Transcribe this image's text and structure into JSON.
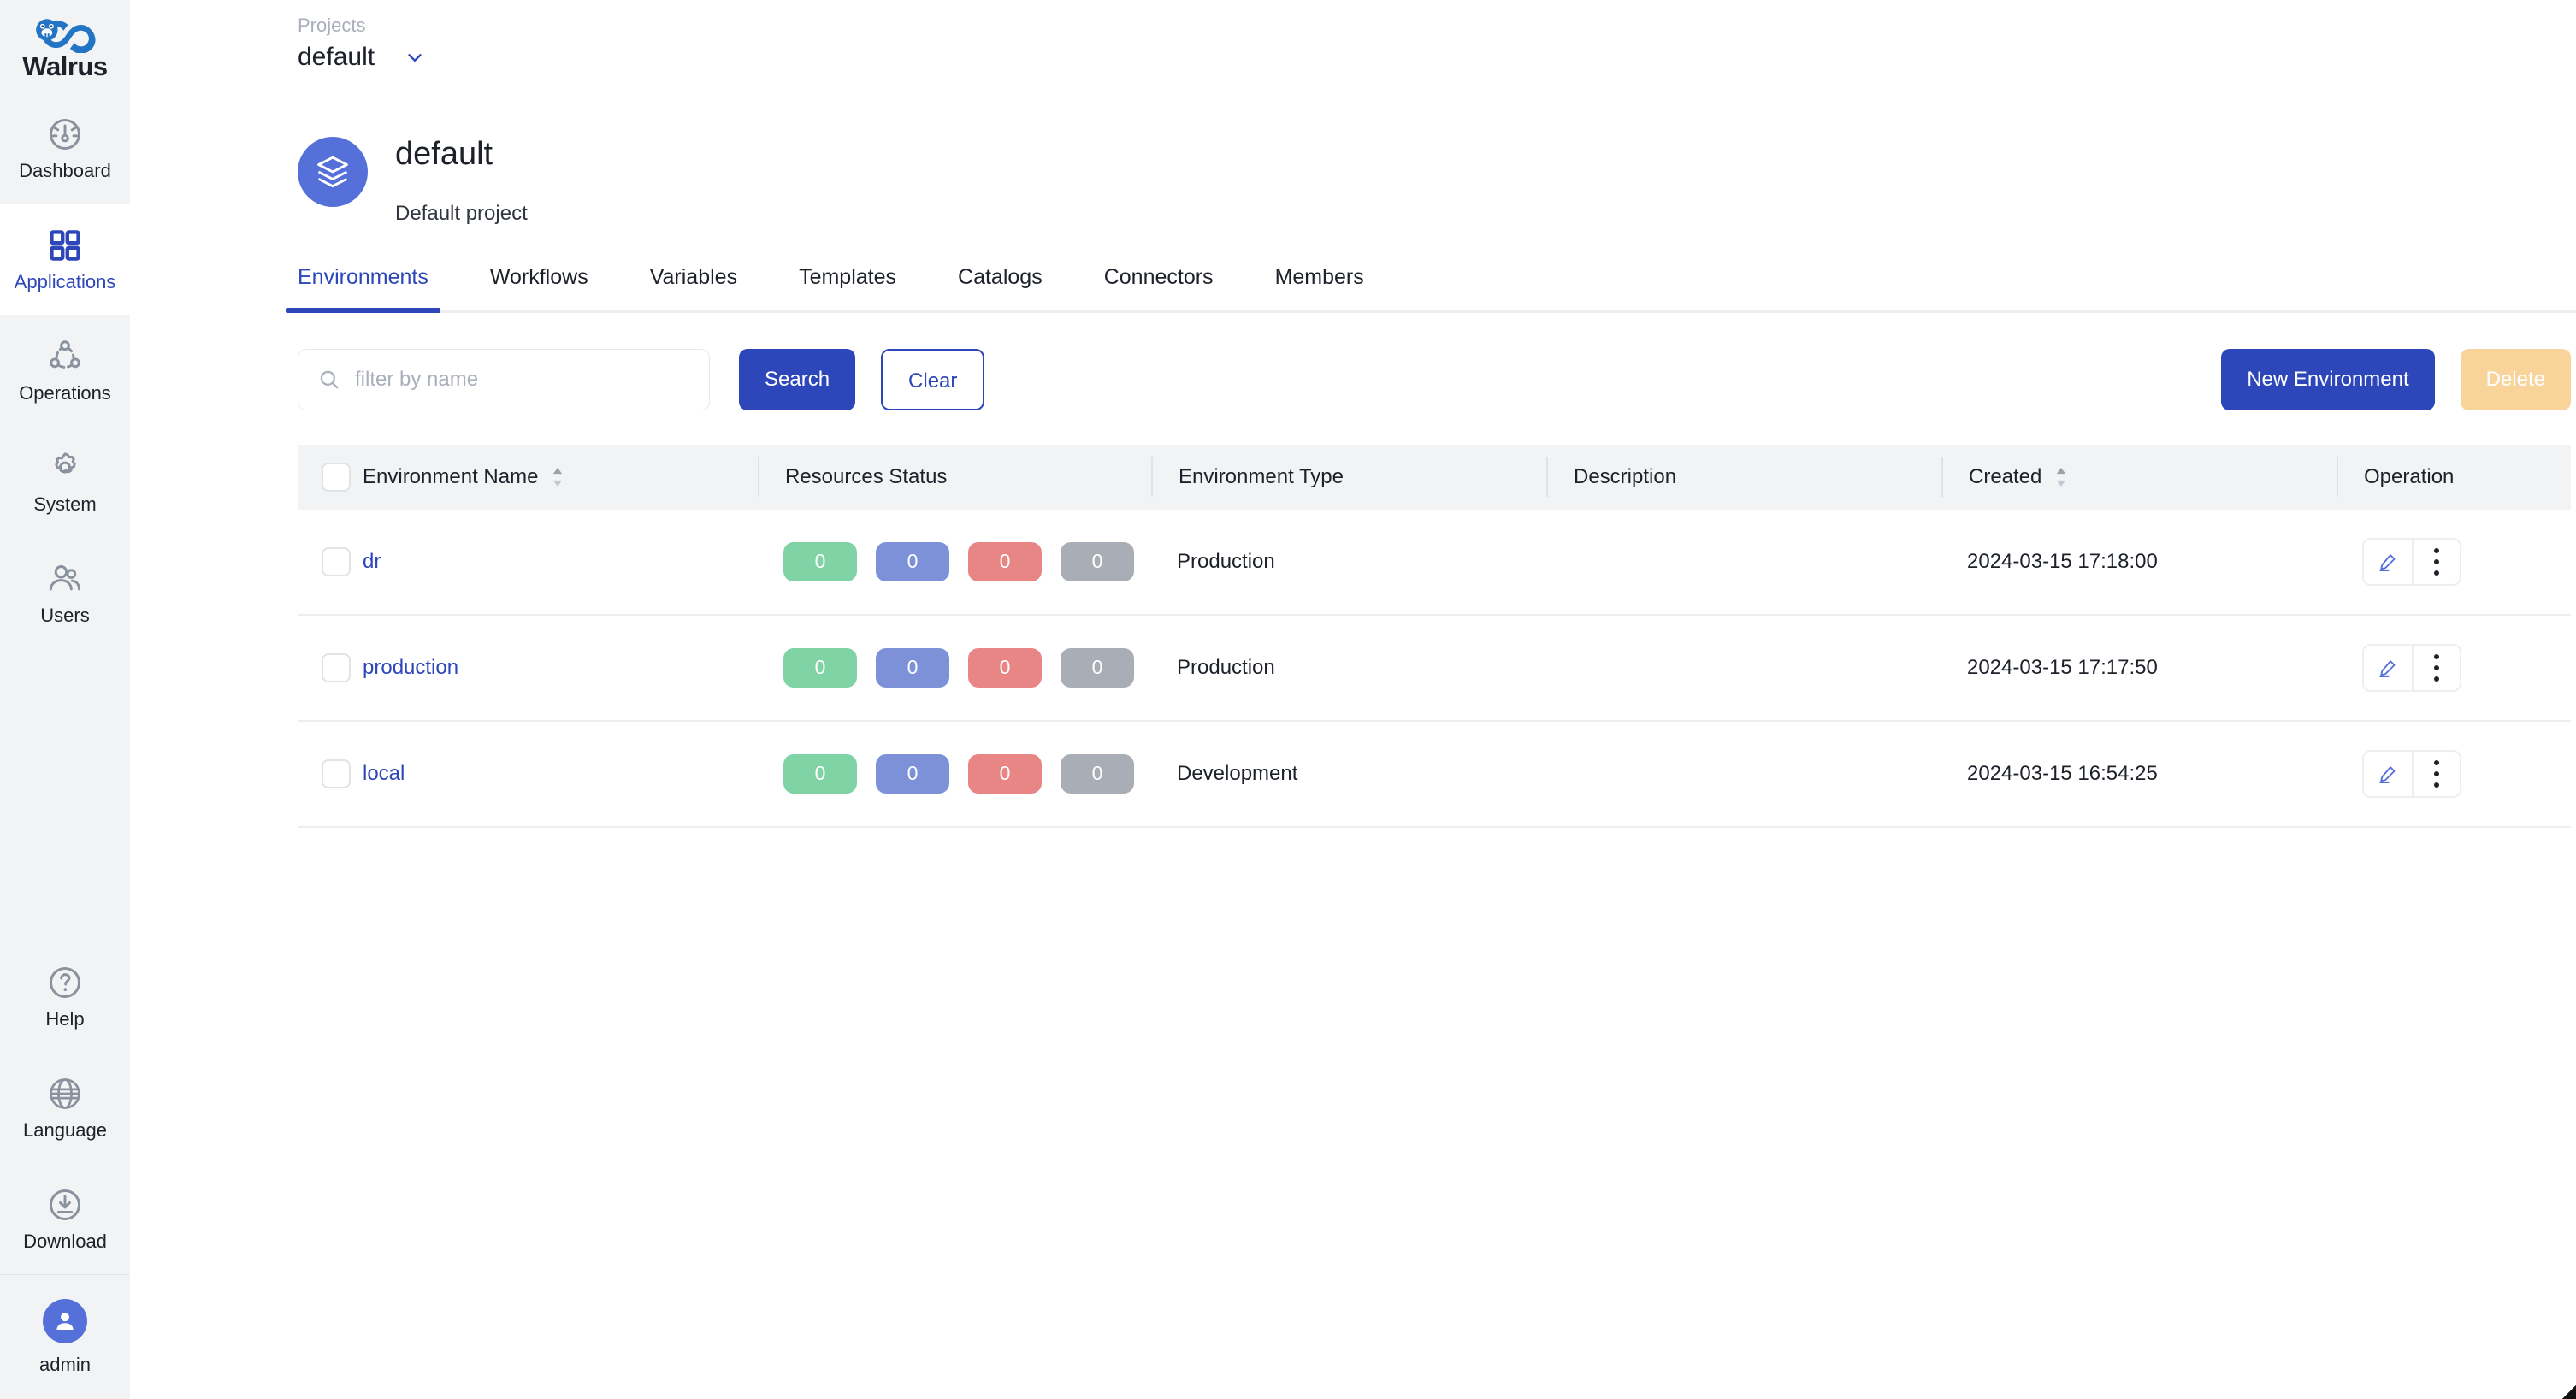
{
  "brand": {
    "name": "Walrus",
    "logo_icon": "walrus-infinity-logo",
    "accent": "#2d46b9"
  },
  "sidebar": {
    "items": [
      {
        "label": "Dashboard",
        "icon": "gauge-icon",
        "active": false
      },
      {
        "label": "Applications",
        "icon": "grid-squares-icon",
        "active": true
      },
      {
        "label": "Operations",
        "icon": "nodes-icon",
        "active": false
      },
      {
        "label": "System",
        "icon": "gear-icon",
        "active": false
      },
      {
        "label": "Users",
        "icon": "users-icon",
        "active": false
      }
    ],
    "bottom_items": [
      {
        "label": "Help",
        "icon": "question-circle-icon"
      },
      {
        "label": "Language",
        "icon": "globe-icon"
      },
      {
        "label": "Download",
        "icon": "download-circle-icon"
      }
    ],
    "user": {
      "name": "admin",
      "icon": "user-avatar-icon"
    }
  },
  "topbar": {
    "breadcrumb": "Projects",
    "selected_project": "default",
    "chevron_icon": "chevron-down-icon"
  },
  "project": {
    "icon": "layers-stack-icon",
    "title": "default",
    "description": "Default project",
    "avatar_color": "#5570d8"
  },
  "tabs": [
    {
      "label": "Environments",
      "active": true
    },
    {
      "label": "Workflows",
      "active": false
    },
    {
      "label": "Variables",
      "active": false
    },
    {
      "label": "Templates",
      "active": false
    },
    {
      "label": "Catalogs",
      "active": false
    },
    {
      "label": "Connectors",
      "active": false
    },
    {
      "label": "Members",
      "active": false
    }
  ],
  "toolbar": {
    "search_placeholder": "filter by name",
    "search_value": "",
    "search_icon": "search-icon",
    "search_label": "Search",
    "clear_label": "Clear",
    "new_environment_label": "New Environment",
    "delete_label": "Delete"
  },
  "table": {
    "columns": [
      {
        "key": "name",
        "label": "Environment Name",
        "sortable": true
      },
      {
        "key": "status",
        "label": "Resources Status",
        "sortable": false
      },
      {
        "key": "type",
        "label": "Environment Type",
        "sortable": false
      },
      {
        "key": "desc",
        "label": "Description",
        "sortable": false
      },
      {
        "key": "created",
        "label": "Created",
        "sortable": true
      },
      {
        "key": "op",
        "label": "Operation",
        "sortable": false
      }
    ],
    "rows": [
      {
        "name": "dr",
        "status": [
          {
            "value": "0",
            "kind": "green"
          },
          {
            "value": "0",
            "kind": "blue"
          },
          {
            "value": "0",
            "kind": "red"
          },
          {
            "value": "0",
            "kind": "gray"
          }
        ],
        "type": "Production",
        "desc": "",
        "created": "2024-03-15 17:18:00"
      },
      {
        "name": "production",
        "status": [
          {
            "value": "0",
            "kind": "green"
          },
          {
            "value": "0",
            "kind": "blue"
          },
          {
            "value": "0",
            "kind": "red"
          },
          {
            "value": "0",
            "kind": "gray"
          }
        ],
        "type": "Production",
        "desc": "",
        "created": "2024-03-15 17:17:50"
      },
      {
        "name": "local",
        "status": [
          {
            "value": "0",
            "kind": "green"
          },
          {
            "value": "0",
            "kind": "blue"
          },
          {
            "value": "0",
            "kind": "red"
          },
          {
            "value": "0",
            "kind": "gray"
          }
        ],
        "type": "Development",
        "desc": "",
        "created": "2024-03-15 16:54:25"
      }
    ],
    "row_actions": {
      "edit_icon": "pencil-edit-icon",
      "more_icon": "more-vertical-icon"
    },
    "sort_icon": "sort-arrows-icon",
    "select_all_icon": "checkbox-icon"
  },
  "colors": {
    "accent": "#2d46b9",
    "sidebar_bg": "#f2f3f5",
    "status_green": "#7fd3a4",
    "status_blue": "#7d91d8",
    "status_red": "#e88585",
    "status_gray": "#a9aeb6",
    "delete_btn": "#f8d49a"
  }
}
